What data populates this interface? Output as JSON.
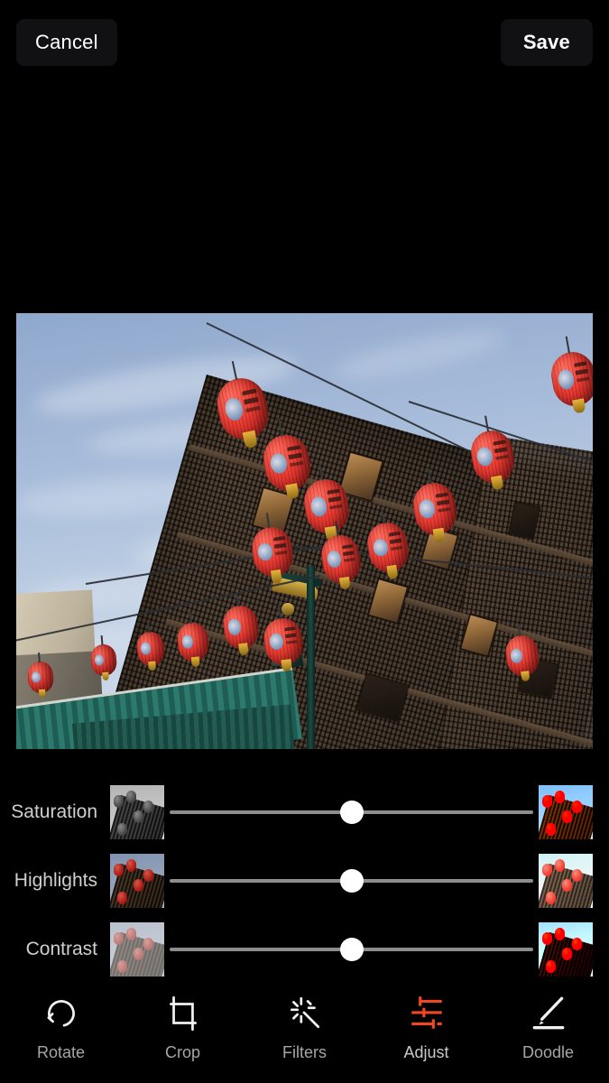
{
  "topbar": {
    "cancel_label": "Cancel",
    "save_label": "Save"
  },
  "photo": {
    "alt": "Red Chinese lanterns strung on wires above a Chinatown street, dark brown textured brick building seen from a low angle against a blue sky with wispy clouds"
  },
  "adjust": {
    "rows": [
      {
        "label": "Saturation",
        "value": 50,
        "left_preview": "desaturated-thumbnail",
        "right_preview": "saturated-thumbnail"
      },
      {
        "label": "Highlights",
        "value": 50,
        "left_preview": "low-highlights-thumbnail",
        "right_preview": "high-highlights-thumbnail"
      },
      {
        "label": "Contrast",
        "value": 50,
        "left_preview": "low-contrast-thumbnail",
        "right_preview": "high-contrast-thumbnail"
      }
    ]
  },
  "toolbar": {
    "active": "Adjust",
    "accent_color": "#EF4823",
    "inactive_color": "#A6A6A6",
    "items": [
      {
        "label": "Rotate",
        "icon": "rotate-left-icon",
        "active": false
      },
      {
        "label": "Crop",
        "icon": "crop-icon",
        "active": false
      },
      {
        "label": "Filters",
        "icon": "magic-wand-icon",
        "active": false
      },
      {
        "label": "Adjust",
        "icon": "sliders-icon",
        "active": true
      },
      {
        "label": "Doodle",
        "icon": "pencil-icon",
        "active": false
      }
    ]
  }
}
